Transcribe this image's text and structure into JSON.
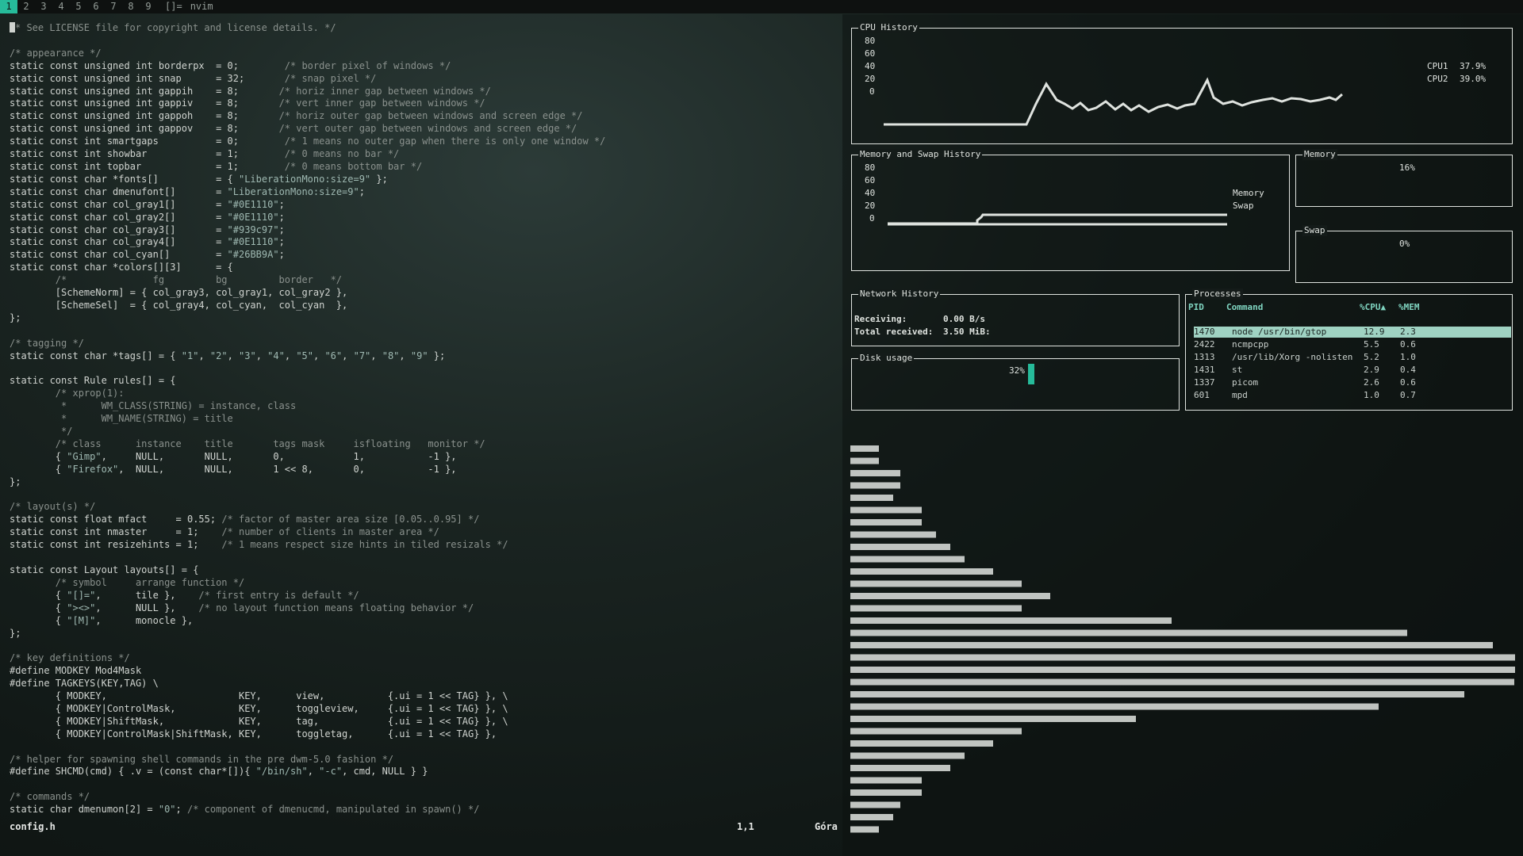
{
  "topbar": {
    "tags": [
      "1",
      "2",
      "3",
      "4",
      "5",
      "6",
      "7",
      "8",
      "9"
    ],
    "active_tag": "1",
    "layout_symbol": "[]=",
    "window_title": "nvim"
  },
  "editor": {
    "filename": "config.h",
    "cursor_pos": "1,1",
    "scroll_pos": "Góra"
  },
  "gtop": {
    "cpu": {
      "title": "CPU History",
      "y_ticks": [
        "80",
        "60",
        "40",
        "20",
        "0"
      ],
      "cpus": [
        {
          "name": "CPU1",
          "value": "37.9%"
        },
        {
          "name": "CPU2",
          "value": "39.0%"
        }
      ]
    },
    "memswap": {
      "title": "Memory and Swap History",
      "y_ticks": [
        "80",
        "60",
        "40",
        "20",
        "0"
      ],
      "legend": [
        "Memory",
        "Swap"
      ]
    },
    "memory": {
      "title": "Memory",
      "value": "16%"
    },
    "swap": {
      "title": "Swap",
      "value": "0%"
    },
    "network": {
      "title": "Network History",
      "receiving_label": "Receiving:",
      "receiving_value": "0.00 B/s",
      "total_label": "Total received:",
      "total_value": "3.50 MiB:"
    },
    "disk": {
      "title": "Disk usage",
      "value": "32%",
      "fraction": 0.32
    },
    "processes": {
      "title": "Processes",
      "columns": [
        "PID",
        "Command",
        "%CPU▲",
        "%MEM"
      ],
      "rows": [
        {
          "pid": "1470",
          "cmd": "node /usr/bin/gtop",
          "cpu": "12.9",
          "mem": "2.3"
        },
        {
          "pid": "2422",
          "cmd": "ncmpcpp",
          "cpu": "5.5",
          "mem": "0.6"
        },
        {
          "pid": "1313",
          "cmd": "/usr/lib/Xorg -nolisten",
          "cpu": "5.2",
          "mem": "1.0"
        },
        {
          "pid": "1431",
          "cmd": "st",
          "cpu": "2.9",
          "mem": "0.4"
        },
        {
          "pid": "1337",
          "cmd": "picom",
          "cpu": "2.6",
          "mem": "0.6"
        },
        {
          "pid": "601",
          "cmd": "mpd",
          "cpu": "1.0",
          "mem": "0.7"
        }
      ]
    }
  },
  "colors": {
    "accent": "#26BB9A",
    "fg": "#939C97",
    "bg": "#0E1110"
  }
}
